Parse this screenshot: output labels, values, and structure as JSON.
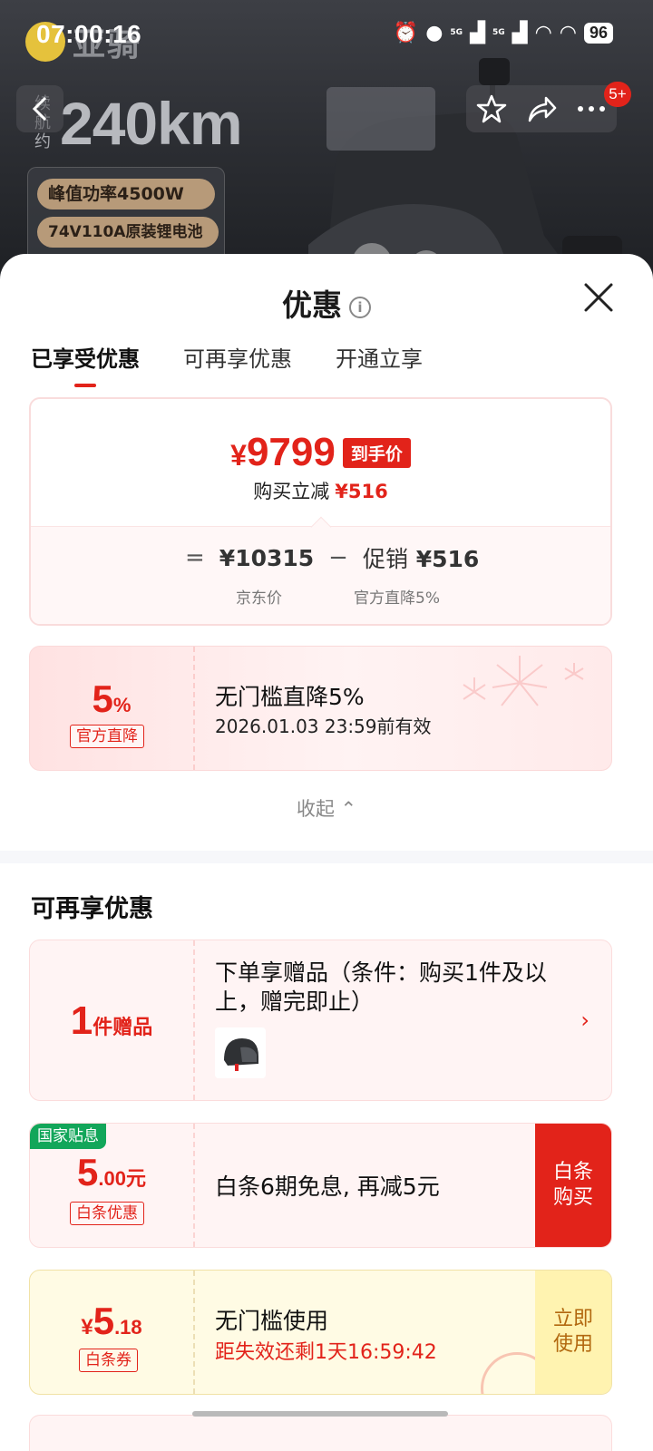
{
  "status_bar": {
    "time": "07:00:16",
    "battery": "96",
    "net1": "5G",
    "net2": "5G"
  },
  "hero": {
    "brand": "亚骑",
    "range_prefix": "续航约",
    "range_value": "240km",
    "spec1": "峰值功率4500W",
    "spec2": "74V110A原装锂电池"
  },
  "nav": {
    "message_badge": "5+",
    "icons": [
      "back-icon",
      "star-icon",
      "share-icon",
      "more-icon"
    ]
  },
  "sheet": {
    "title": "优惠",
    "info_glyph": "i",
    "tabs": [
      {
        "label": "已享受优惠",
        "active": true
      },
      {
        "label": "可再享优惠",
        "active": false
      },
      {
        "label": "开通立享",
        "active": false
      }
    ],
    "price": {
      "yen": "¥",
      "final": "9799",
      "tag": "到手价",
      "save_label": "购买立减",
      "save_amount": "¥516",
      "eq": "=",
      "jd_price": "¥10315",
      "minus": "−",
      "promo_label": "促销",
      "promo_amount": "¥516",
      "jd_price_label": "京东价",
      "promo_sub": "官方直降5%"
    },
    "discount_card": {
      "value": "5",
      "unit": "%",
      "tag": "官方直降",
      "title": "无门槛直降5%",
      "valid": "2026.01.03 23:59前有效"
    },
    "collapse_label": "收起 ⌃",
    "section_title": "可再享优惠",
    "gift_card": {
      "value": "1",
      "unit": "件赠品",
      "title": "下单享赠品（条件：购买1件及以上，赠完即止）",
      "chevron": "›"
    },
    "baitiao_card": {
      "flag": "国家贴息",
      "value": "5",
      "unit": ".00元",
      "tag": "白条优惠",
      "title": "白条6期免息, 再减5元",
      "cta_line1": "白条",
      "cta_line2": "购买"
    },
    "coupon_card": {
      "yen": "¥",
      "value": "5",
      "unit": ".18",
      "tag": "白条券",
      "title": "无门槛使用",
      "countdown": "距失效还剩1天16:59:42",
      "cta_line1": "立即",
      "cta_line2": "使用"
    }
  },
  "colors": {
    "accent": "#e2231a",
    "green_flag": "#12a65a",
    "coupon_yellow": "#fffbe4"
  }
}
